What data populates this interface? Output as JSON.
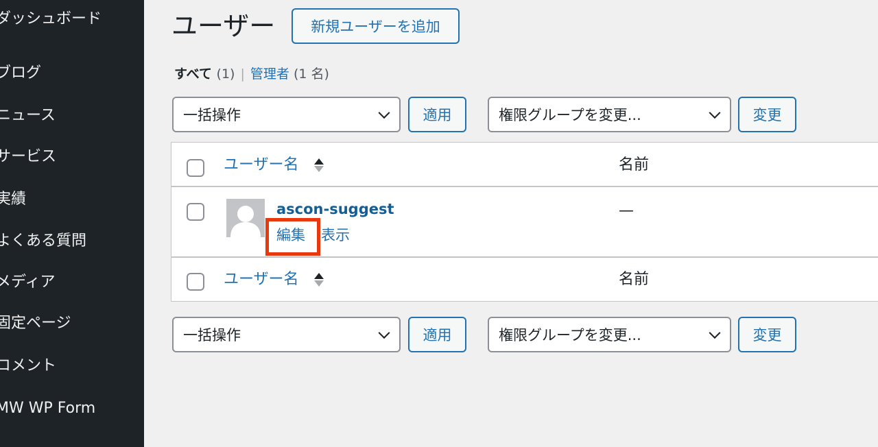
{
  "sidebar": {
    "items": [
      {
        "label": "ダッシュボード"
      },
      {
        "label": "ブログ"
      },
      {
        "label": "ニュース"
      },
      {
        "label": "サービス"
      },
      {
        "label": "実績"
      },
      {
        "label": "よくある質問"
      },
      {
        "label": "メディア"
      },
      {
        "label": "固定ページ"
      },
      {
        "label": "コメント"
      },
      {
        "label": "MW WP Form"
      }
    ]
  },
  "header": {
    "title": "ユーザー",
    "add_new_label": "新規ユーザーを追加"
  },
  "filters": {
    "all_label": "すべて",
    "all_count": "(1)",
    "separator": "|",
    "admin_label": "管理者",
    "admin_count": "(1 名)"
  },
  "bulk_top": {
    "bulk_action_value": "一括操作",
    "apply_label": "適用",
    "role_select_value": "権限グループを変更...",
    "change_label": "変更"
  },
  "bulk_bottom": {
    "bulk_action_value": "一括操作",
    "apply_label": "適用",
    "role_select_value": "権限グループを変更...",
    "change_label": "変更"
  },
  "table": {
    "columns": {
      "username": "ユーザー名",
      "name": "名前"
    },
    "rows": [
      {
        "username": "ascon-suggest",
        "name": "—",
        "actions": {
          "edit": "編集",
          "view": "表示"
        }
      }
    ]
  },
  "colors": {
    "sidebar_bg": "#1d2327",
    "link": "#2271b1",
    "highlight": "#e8390e"
  }
}
